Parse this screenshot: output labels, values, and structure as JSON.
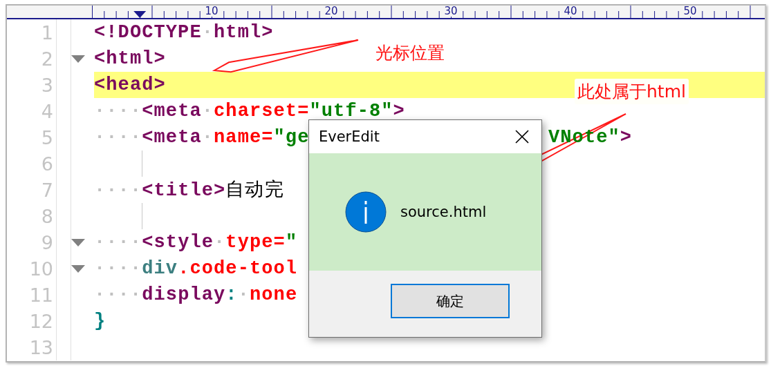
{
  "ruler": {
    "labels": [
      "10",
      "20",
      "30",
      "40",
      "50"
    ]
  },
  "lines": [
    {
      "number": "1",
      "fold": false,
      "current": false,
      "guide": false,
      "tokens": [
        {
          "kind": "tag",
          "text": "<!DOCTYPE"
        },
        {
          "kind": "ws",
          "text": "·"
        },
        {
          "kind": "tag",
          "text": "html>"
        }
      ]
    },
    {
      "number": "2",
      "fold": true,
      "current": false,
      "guide": false,
      "tokens": [
        {
          "kind": "tag",
          "text": "<html>"
        }
      ]
    },
    {
      "number": "3",
      "fold": false,
      "current": true,
      "guide": false,
      "tokens": [
        {
          "kind": "tag",
          "text": "<head>"
        }
      ]
    },
    {
      "number": "4",
      "fold": false,
      "current": false,
      "guide": false,
      "tokens": [
        {
          "kind": "ws",
          "text": "····"
        },
        {
          "kind": "tag",
          "text": "<meta"
        },
        {
          "kind": "ws",
          "text": "·"
        },
        {
          "kind": "attr",
          "text": "charset="
        },
        {
          "kind": "string",
          "text": "\"utf-8\""
        },
        {
          "kind": "tag",
          "text": ">"
        }
      ]
    },
    {
      "number": "5",
      "fold": false,
      "current": false,
      "guide": false,
      "tokens": [
        {
          "kind": "ws",
          "text": "····"
        },
        {
          "kind": "tag",
          "text": "<meta"
        },
        {
          "kind": "ws",
          "text": "·"
        },
        {
          "kind": "attr",
          "text": "name="
        },
        {
          "kind": "string",
          "text": "\"ge"
        }
      ],
      "tokens_after_dialog": [
        {
          "kind": "string",
          "text": "VNote\""
        },
        {
          "kind": "tag",
          "text": ">"
        }
      ]
    },
    {
      "number": "6",
      "fold": false,
      "current": false,
      "guide": true
    },
    {
      "number": "7",
      "fold": false,
      "current": false,
      "guide": false,
      "tokens": [
        {
          "kind": "ws",
          "text": "····"
        },
        {
          "kind": "tag",
          "text": "<title>"
        },
        {
          "kind": "text",
          "text": "自动完"
        }
      ]
    },
    {
      "number": "8",
      "fold": false,
      "current": false,
      "guide": true
    },
    {
      "number": "9",
      "fold": true,
      "current": false,
      "guide": false,
      "tokens": [
        {
          "kind": "ws",
          "text": "····"
        },
        {
          "kind": "tag",
          "text": "<style"
        },
        {
          "kind": "ws",
          "text": "·"
        },
        {
          "kind": "attr",
          "text": "type="
        },
        {
          "kind": "string",
          "text": "\""
        }
      ]
    },
    {
      "number": "10",
      "fold": true,
      "current": false,
      "guide": false,
      "tokens": [
        {
          "kind": "ws",
          "text": "····"
        },
        {
          "kind": "selector",
          "text": "div"
        },
        {
          "kind": "attr",
          "text": ".code-tool"
        }
      ]
    },
    {
      "number": "11",
      "fold": false,
      "current": false,
      "guide": false,
      "tokens": [
        {
          "kind": "ws",
          "text": "····"
        },
        {
          "kind": "tag",
          "text": "display"
        },
        {
          "kind": "punct",
          "text": ":"
        },
        {
          "kind": "ws",
          "text": "·"
        },
        {
          "kind": "attr",
          "text": "none"
        }
      ]
    },
    {
      "number": "12",
      "fold": false,
      "current": false,
      "guide": false,
      "tokens": [
        {
          "kind": "punct",
          "text": "}"
        }
      ]
    },
    {
      "number": "13",
      "fold": false,
      "current": false,
      "guide": false
    }
  ],
  "dialog": {
    "title": "EverEdit",
    "message": "source.html",
    "button": "确定"
  },
  "annotations": [
    {
      "text": "光标位置"
    },
    {
      "text": "此处属于html"
    }
  ]
}
